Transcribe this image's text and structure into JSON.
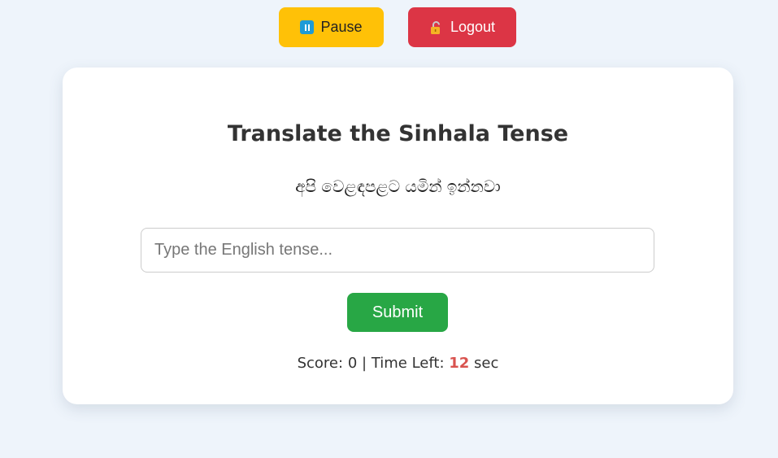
{
  "topbar": {
    "pause_label": "Pause",
    "logout_label": "Logout",
    "pause_icon": "pause-icon",
    "logout_icon": "unlocked-lock-icon",
    "pause_color": "#ffc107",
    "logout_color": "#dc3545"
  },
  "quiz": {
    "title": "Translate the Sinhala Tense",
    "sinhala_sentence": "අපි වෙළඳපළට යමින් ඉන්නවා",
    "input_placeholder": "Type the English tense...",
    "input_value": "",
    "submit_label": "Submit",
    "submit_color": "#28a745"
  },
  "status": {
    "score_label": "Score:",
    "score_value": "0",
    "separator": "|",
    "time_label": "Time Left:",
    "time_value": "12",
    "time_unit": "sec"
  }
}
